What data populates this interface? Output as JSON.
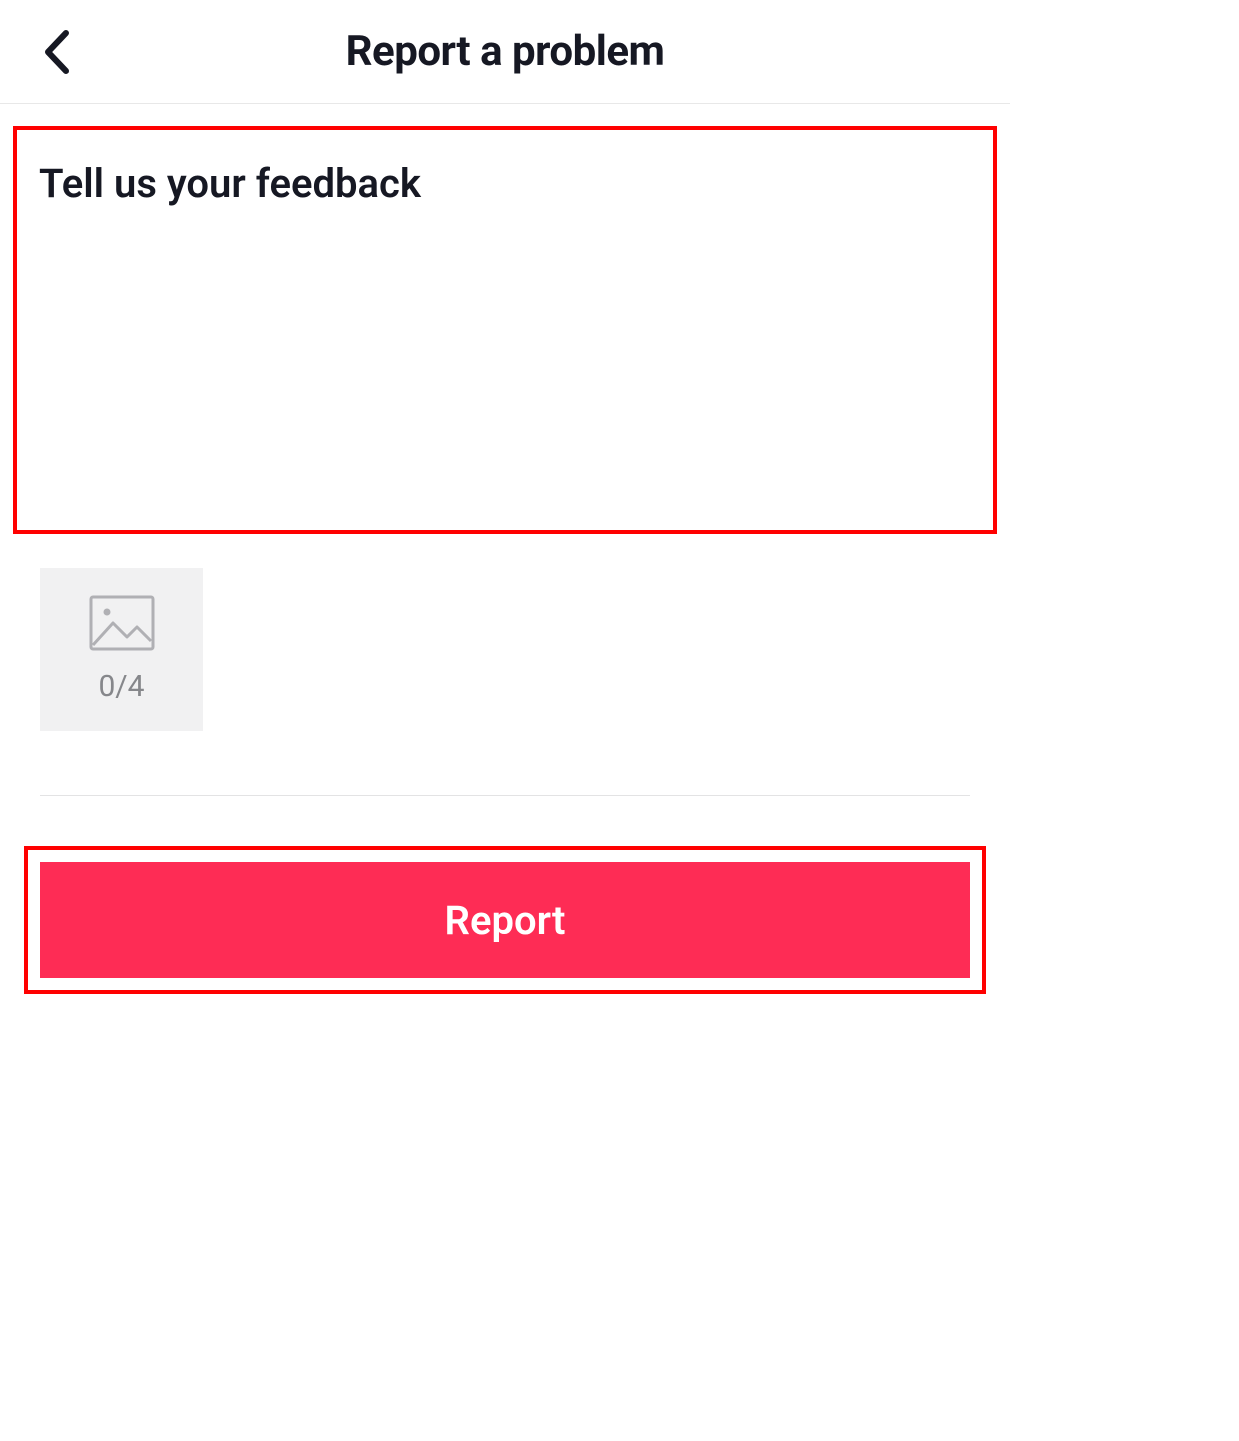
{
  "header": {
    "title": "Report a problem"
  },
  "feedback": {
    "placeholder": "Tell us your feedback",
    "value": ""
  },
  "upload": {
    "count_text": "0/4"
  },
  "actions": {
    "report_label": "Report"
  }
}
